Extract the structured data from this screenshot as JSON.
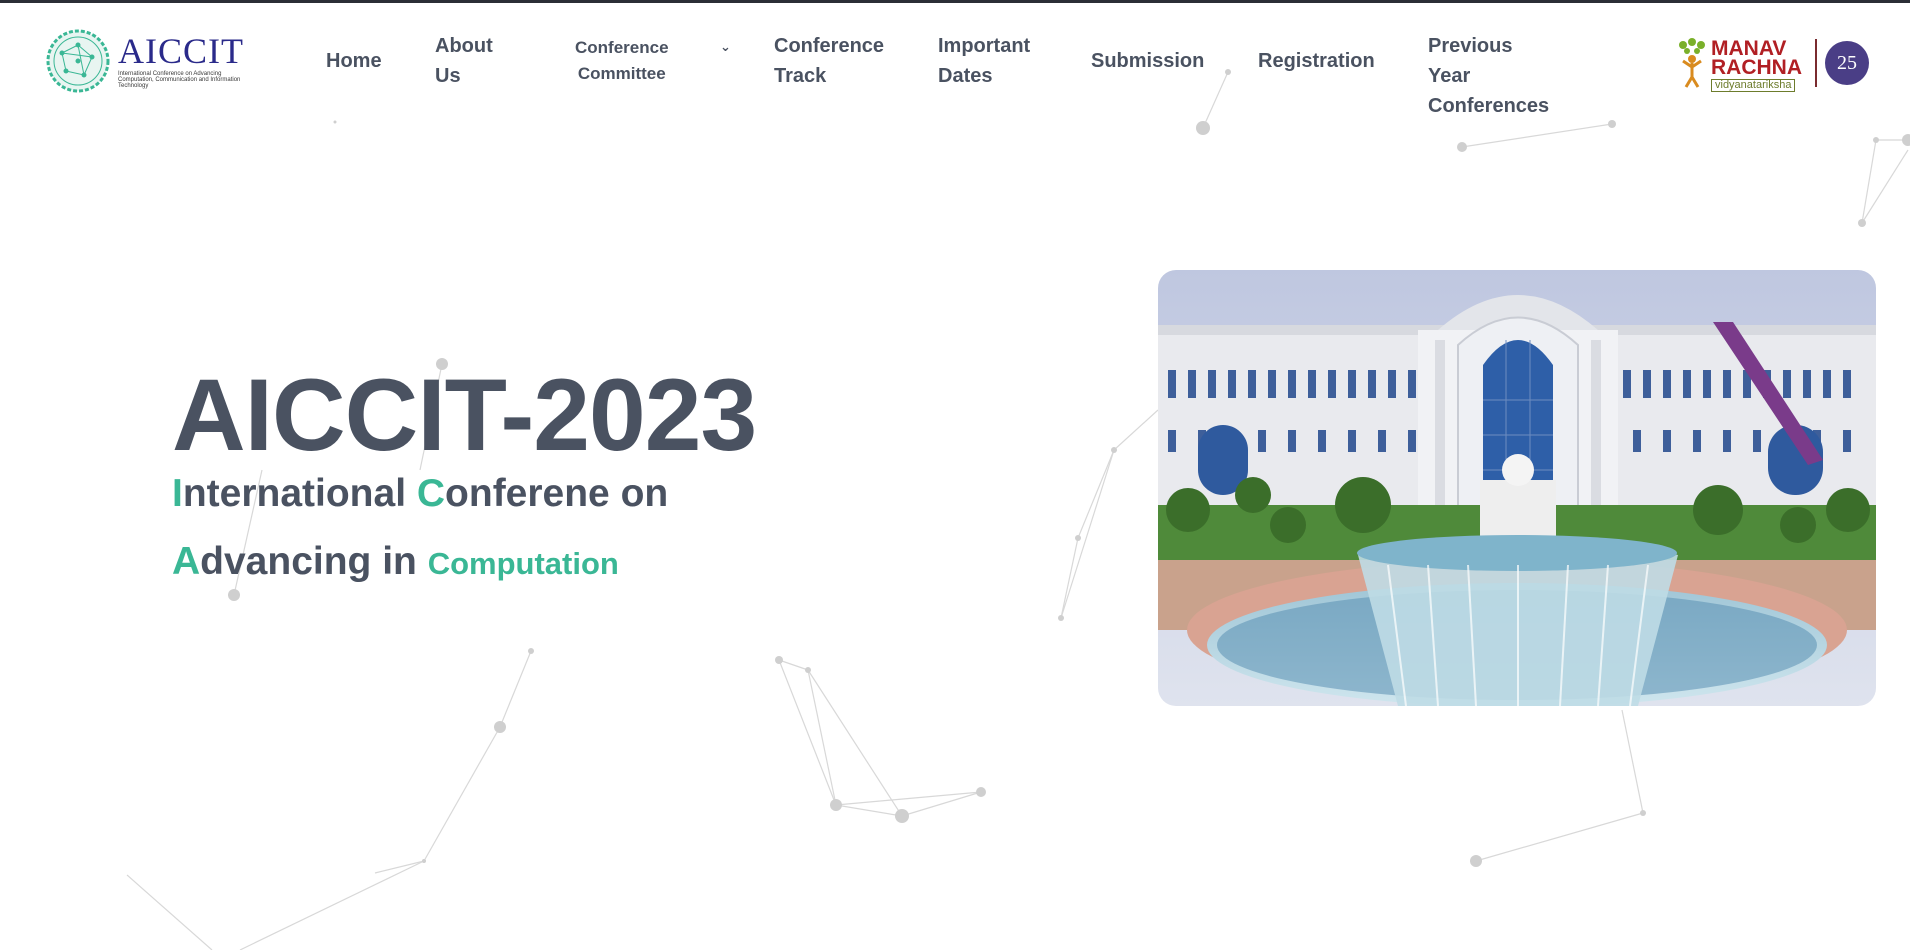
{
  "header": {
    "logo": {
      "title": "AICCIT",
      "subtitle": "International Conference on Advancing Computation, Communication and Information Technology"
    },
    "nav": [
      {
        "line1": "Home",
        "line2": ""
      },
      {
        "line1": "About",
        "line2": "Us"
      },
      {
        "line1": "Conference",
        "line2": "Committee"
      },
      {
        "line1": "Conference",
        "line2": "Track"
      },
      {
        "line1": "Important",
        "line2": "Dates"
      },
      {
        "line1": "Submission",
        "line2": ""
      },
      {
        "line1": "Registration",
        "line2": ""
      },
      {
        "line1": "Previous Year",
        "line2": "Conferences"
      }
    ],
    "dropdown_icon": "chevron-down-icon",
    "partner_logo": {
      "line1": "MANAV",
      "line2": "RACHNA",
      "tagline": "vidyanatariksha",
      "badge": "25"
    }
  },
  "hero": {
    "title": "AICCIT-2023",
    "line1": {
      "a1": "I",
      "rest1": "nternational ",
      "a2": "C",
      "rest2": "onferene on"
    },
    "line2": {
      "a1": "A",
      "rest1": "dvancing in ",
      "tail": "Computation"
    }
  },
  "image": {
    "name": "campus-building-photo"
  },
  "colors": {
    "accent": "#3ab795",
    "text": "#4a5261",
    "brand": "#2a2a8a",
    "partner": "#b11f24"
  }
}
